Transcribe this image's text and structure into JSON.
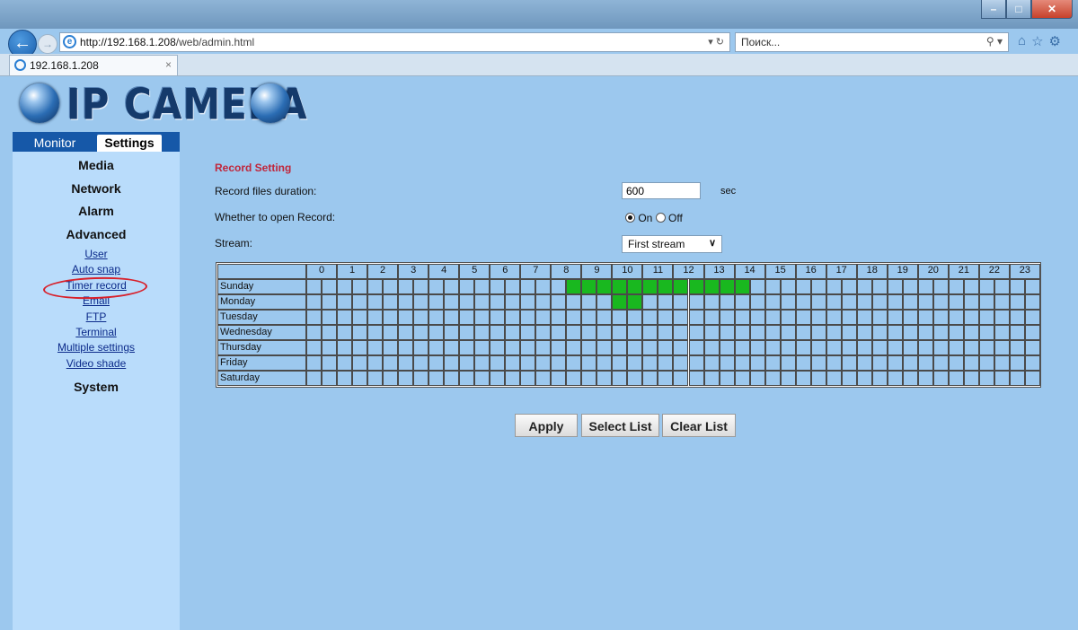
{
  "browser": {
    "url_host": "http://192.168.1.208",
    "url_path": "/web/admin.html",
    "search_placeholder": "Поиск...",
    "tab_title": "192.168.1.208"
  },
  "logo": "IP CAMERA",
  "menu": {
    "tabs": [
      "Monitor",
      "Settings"
    ],
    "active_tab": "Settings",
    "media": "Media",
    "network": "Network",
    "alarm": "Alarm",
    "advanced": "Advanced",
    "advanced_items": [
      "User",
      "Auto snap",
      "Timer record",
      "Email",
      "FTP",
      "Terminal",
      "Multiple settings",
      "Video shade"
    ],
    "system": "System",
    "selected_item": "Timer record"
  },
  "form": {
    "title": "Record Setting",
    "duration_label": "Record files duration:",
    "duration_value": "600",
    "duration_unit": "sec",
    "record_label": "Whether to open Record:",
    "record_on_label": "On",
    "record_off_label": "Off",
    "record_selected": "On",
    "stream_label": "Stream:",
    "stream_value": "First stream"
  },
  "schedule": {
    "hours": [
      "0",
      "1",
      "2",
      "3",
      "4",
      "5",
      "6",
      "7",
      "8",
      "9",
      "10",
      "11",
      "12",
      "13",
      "14",
      "15",
      "16",
      "17",
      "18",
      "19",
      "20",
      "21",
      "22",
      "23"
    ],
    "days": [
      "Sunday",
      "Monday",
      "Tuesday",
      "Wednesday",
      "Thursday",
      "Friday",
      "Saturday"
    ],
    "slots_per_hour": 2,
    "active_slots": {
      "Sunday": [
        17,
        18,
        19,
        20,
        21,
        22,
        23,
        24,
        25,
        26,
        27,
        28
      ],
      "Monday": [
        20,
        21
      ]
    }
  },
  "buttons": {
    "apply": "Apply",
    "select_list": "Select List",
    "clear_list": "Clear List"
  },
  "colors": {
    "background": "#9cc8ee",
    "nav_tab_bar": "#1658a8",
    "section_title": "#c0263b",
    "active_slot": "#19b81f",
    "highlight_circle": "#d8202a"
  }
}
